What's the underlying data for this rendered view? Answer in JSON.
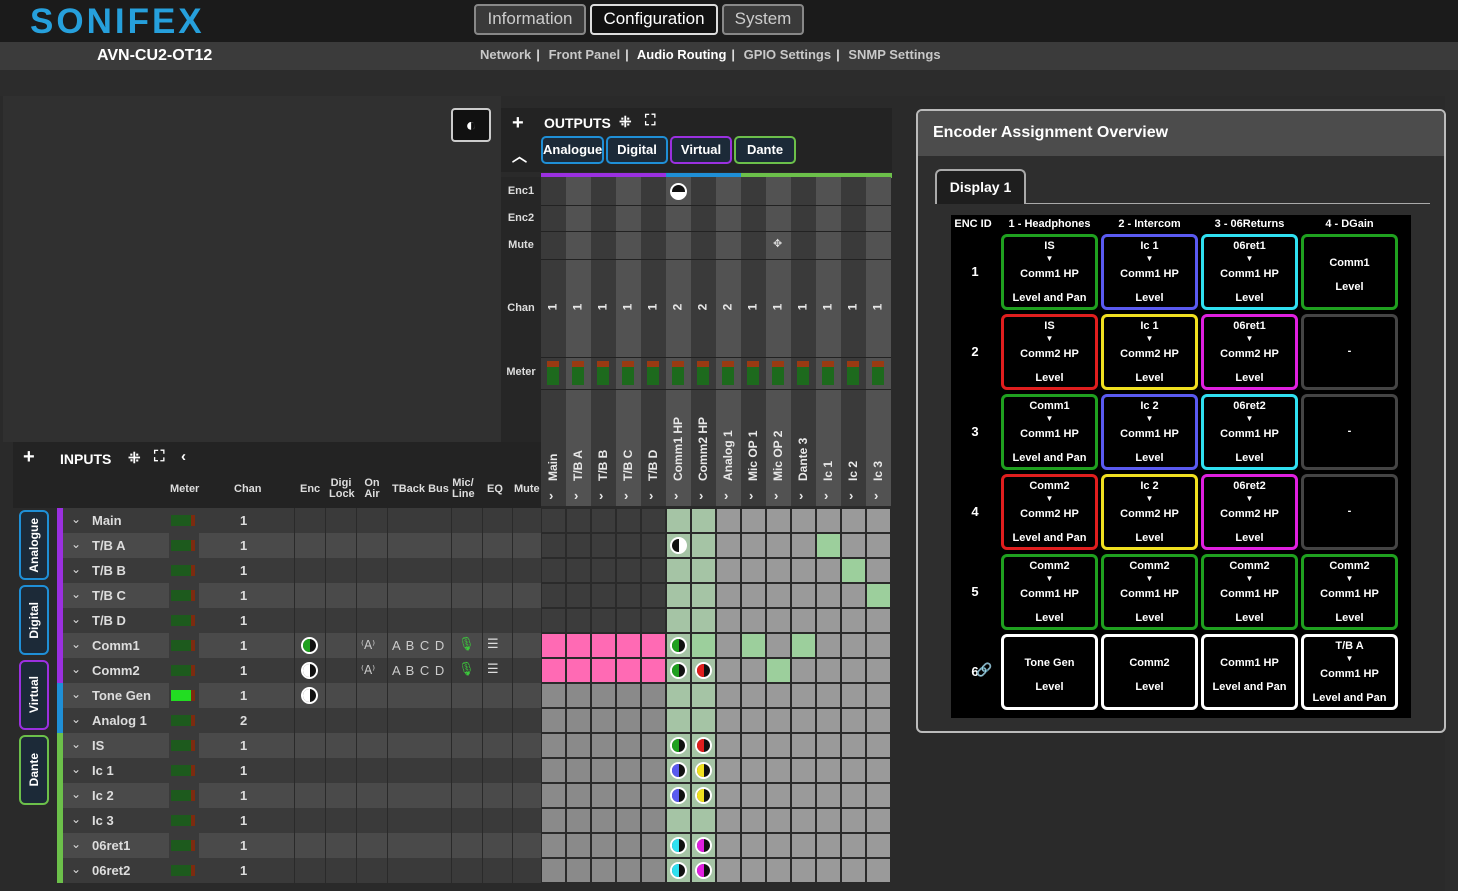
{
  "header": {
    "logo": "SONIFEX",
    "tabs": [
      {
        "label": "Information"
      },
      {
        "label": "Configuration"
      },
      {
        "label": "System"
      }
    ],
    "device": "AVN-CU2-OT12",
    "subnav": [
      "Network",
      "Front Panel",
      "Audio Routing",
      "GPIO Settings",
      "SNMP Settings"
    ],
    "active_subnav": "Audio Routing"
  },
  "outputs": {
    "title": "OUTPUTS",
    "groups": [
      "Analogue",
      "Digital",
      "Virtual",
      "Dante"
    ],
    "row_labels": [
      "Enc1",
      "Enc2",
      "Mute",
      "Chan",
      "Meter"
    ],
    "columns": [
      {
        "name": "Main",
        "chan": "1"
      },
      {
        "name": "T/B A",
        "chan": "1"
      },
      {
        "name": "T/B B",
        "chan": "1"
      },
      {
        "name": "T/B C",
        "chan": "1"
      },
      {
        "name": "T/B D",
        "chan": "1"
      },
      {
        "name": "Comm1 HP",
        "chan": "2"
      },
      {
        "name": "Comm2 HP",
        "chan": "2"
      },
      {
        "name": "Analog 1",
        "chan": "2"
      },
      {
        "name": "Mic OP 1",
        "chan": "1"
      },
      {
        "name": "Mic OP 2",
        "chan": "1"
      },
      {
        "name": "Dante 3",
        "chan": "1"
      },
      {
        "name": "Ic 1",
        "chan": "1"
      },
      {
        "name": "Ic 2",
        "chan": "1"
      },
      {
        "name": "Ic 3",
        "chan": "1"
      }
    ]
  },
  "inputs": {
    "title": "INPUTS",
    "side_tabs": [
      "Analogue",
      "Digital",
      "Virtual",
      "Dante"
    ],
    "headers": [
      "Meter",
      "Chan",
      "Enc",
      "Digi Lock",
      "On Air",
      "TBack Bus",
      "Mic/ Line",
      "EQ",
      "Mute"
    ],
    "tback_letters": "A B C D",
    "rows": [
      {
        "name": "Main",
        "chan": "1"
      },
      {
        "name": "T/B A",
        "chan": "1"
      },
      {
        "name": "T/B B",
        "chan": "1"
      },
      {
        "name": "T/B C",
        "chan": "1"
      },
      {
        "name": "T/B D",
        "chan": "1"
      },
      {
        "name": "Comm1",
        "chan": "1"
      },
      {
        "name": "Comm2",
        "chan": "1"
      },
      {
        "name": "Tone Gen",
        "chan": "1"
      },
      {
        "name": "Analog 1",
        "chan": "2"
      },
      {
        "name": "IS",
        "chan": "1"
      },
      {
        "name": "Ic 1",
        "chan": "1"
      },
      {
        "name": "Ic 2",
        "chan": "1"
      },
      {
        "name": "Ic 3",
        "chan": "1"
      },
      {
        "name": "06ret1",
        "chan": "1"
      },
      {
        "name": "06ret2",
        "chan": "1"
      }
    ]
  },
  "encoder": {
    "title": "Encoder Assignment Overview",
    "tab": "Display 1",
    "columns": [
      "ENC ID",
      "1 - Headphones",
      "2 - Intercom",
      "3 - 06Returns",
      "4 - DGain"
    ],
    "ids": [
      "1",
      "2",
      "3",
      "4",
      "5",
      "6"
    ],
    "cells": [
      [
        {
          "a": "IS",
          "b": "Comm1 HP",
          "c": "Level and Pan",
          "color": "#1fa01f"
        },
        {
          "a": "Ic 1",
          "b": "Comm1 HP",
          "c": "Level",
          "color": "#5a5af0"
        },
        {
          "a": "06ret1",
          "b": "Comm1 HP",
          "c": "Level",
          "color": "#30e0f0"
        },
        {
          "a": "",
          "b": "Comm1",
          "c": "Level",
          "color": "#1fa01f"
        }
      ],
      [
        {
          "a": "IS",
          "b": "Comm2 HP",
          "c": "Level",
          "color": "#e01e1e"
        },
        {
          "a": "Ic 1",
          "b": "Comm2 HP",
          "c": "Level",
          "color": "#f0e020"
        },
        {
          "a": "06ret1",
          "b": "Comm2 HP",
          "c": "Level",
          "color": "#e020e0"
        },
        {
          "a": "",
          "b": "-",
          "c": "",
          "color": "#444"
        }
      ],
      [
        {
          "a": "Comm1",
          "b": "Comm1 HP",
          "c": "Level and Pan",
          "color": "#1fa01f"
        },
        {
          "a": "Ic 2",
          "b": "Comm1 HP",
          "c": "Level",
          "color": "#5a5af0"
        },
        {
          "a": "06ret2",
          "b": "Comm1 HP",
          "c": "Level",
          "color": "#30e0f0"
        },
        {
          "a": "",
          "b": "-",
          "c": "",
          "color": "#444"
        }
      ],
      [
        {
          "a": "Comm2",
          "b": "Comm2 HP",
          "c": "Level and Pan",
          "color": "#e01e1e"
        },
        {
          "a": "Ic 2",
          "b": "Comm2 HP",
          "c": "Level",
          "color": "#f0e020"
        },
        {
          "a": "06ret2",
          "b": "Comm2 HP",
          "c": "Level",
          "color": "#e020e0"
        },
        {
          "a": "",
          "b": "-",
          "c": "",
          "color": "#444"
        }
      ],
      [
        {
          "a": "Comm2",
          "b": "Comm1 HP",
          "c": "Level",
          "color": "#1fa01f"
        },
        {
          "a": "Comm2",
          "b": "Comm1 HP",
          "c": "Level",
          "color": "#1fa01f"
        },
        {
          "a": "Comm2",
          "b": "Comm1 HP",
          "c": "Level",
          "color": "#1fa01f"
        },
        {
          "a": "Comm2",
          "b": "Comm1 HP",
          "c": "Level",
          "color": "#1fa01f"
        }
      ],
      [
        {
          "a": "",
          "b": "Tone Gen",
          "c": "Level",
          "color": "#ffffff"
        },
        {
          "a": "",
          "b": "Comm2",
          "c": "Level",
          "color": "#ffffff"
        },
        {
          "a": "",
          "b": "Comm1 HP",
          "c": "Level and Pan",
          "color": "#ffffff"
        },
        {
          "a": "T/B A",
          "b": "Comm1 HP",
          "c": "Level and Pan",
          "color": "#ffffff"
        }
      ]
    ]
  },
  "colors": {
    "analogue": "#9b30e0",
    "digital": "#1f8fd6",
    "dante": "#6cc04a",
    "pink": "#ff6ab4",
    "route_green": "#9ccf9c"
  }
}
